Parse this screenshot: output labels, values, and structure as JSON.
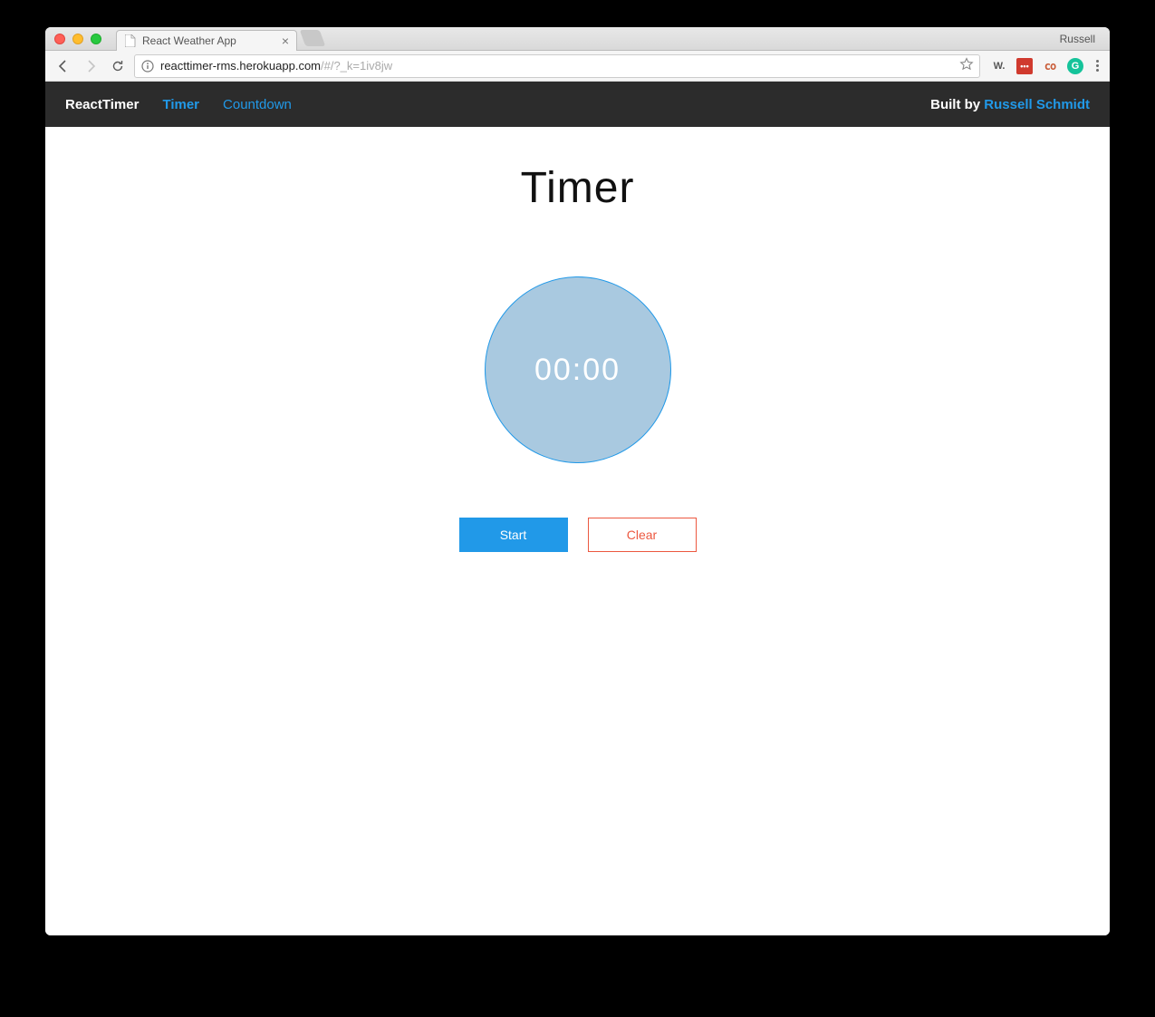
{
  "browser": {
    "profile_name": "Russell",
    "tab_title": "React Weather App",
    "url_host": "reacttimer-rms.herokuapp.com",
    "url_path": "/#/?_k=1iv8jw"
  },
  "extensions": {
    "wappalyzer": "W.",
    "lastpass": "•••",
    "codepen": "co",
    "grammarly": "G"
  },
  "nav": {
    "brand": "ReactTimer",
    "links": [
      {
        "label": "Timer",
        "active": true
      },
      {
        "label": "Countdown",
        "active": false
      }
    ],
    "built_prefix": "Built by ",
    "built_author": "Russell Schmidt"
  },
  "page": {
    "title": "Timer",
    "clock_display": "00:00",
    "start_label": "Start",
    "clear_label": "Clear"
  }
}
